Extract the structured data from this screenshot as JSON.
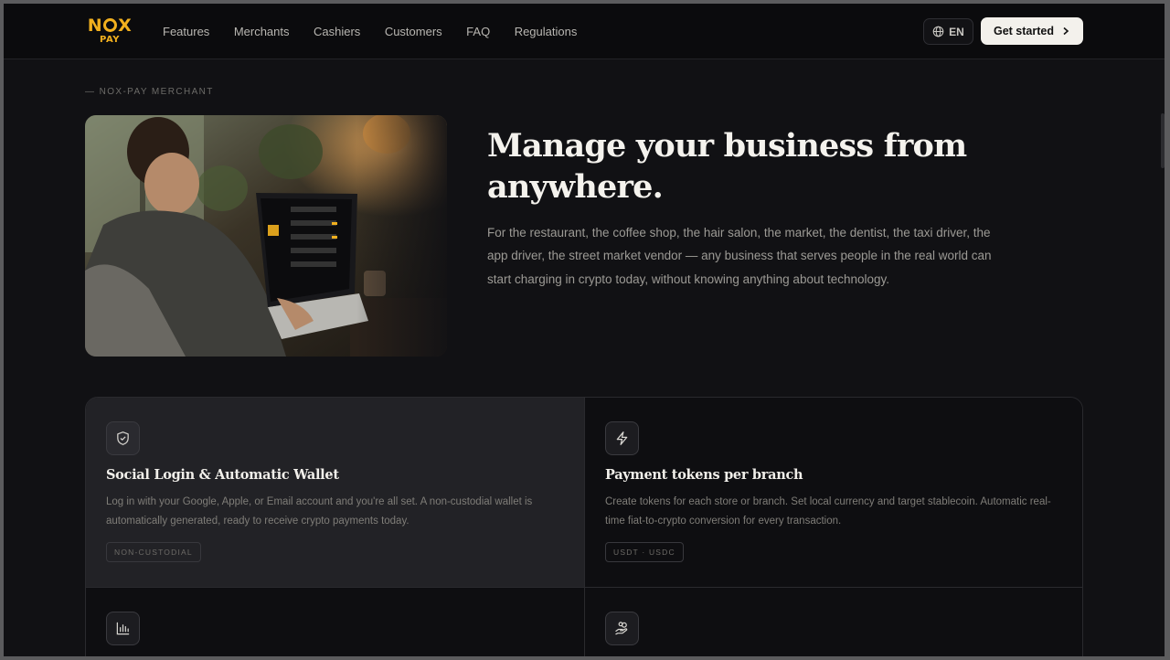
{
  "brand": {
    "logo_top": "NOX",
    "logo_bottom": "PAY",
    "accent": "#f2b01e"
  },
  "nav": {
    "links": [
      "Features",
      "Merchants",
      "Cashiers",
      "Customers",
      "FAQ",
      "Regulations"
    ],
    "language": "EN",
    "cta": "Get started"
  },
  "hero": {
    "eyebrow": "— NOX-PAY MERCHANT",
    "title": "Manage your business from anywhere.",
    "description": "For the restaurant, the coffee shop, the hair salon, the market, the dentist, the taxi driver, the app driver, the street market vendor — any business that serves people in the real world can start charging in crypto today, without knowing anything about technology.",
    "image": "person-using-laptop-with-nox-pay-dashboard"
  },
  "features": [
    {
      "icon": "shield-check-icon",
      "title": "Social Login & Automatic Wallet",
      "description": "Log in with your Google, Apple, or Email account and you're all set. A non-custodial wallet is automatically generated, ready to receive crypto payments today.",
      "tag": "NON-CUSTODIAL"
    },
    {
      "icon": "lightning-icon",
      "title": "Payment tokens per branch",
      "description": "Create tokens for each store or branch. Set local currency and target stablecoin. Automatic real-time fiat-to-crypto conversion for every transaction.",
      "tag": "USDT · USDC"
    },
    {
      "icon": "bar-chart-icon"
    },
    {
      "icon": "hand-coins-icon"
    }
  ]
}
